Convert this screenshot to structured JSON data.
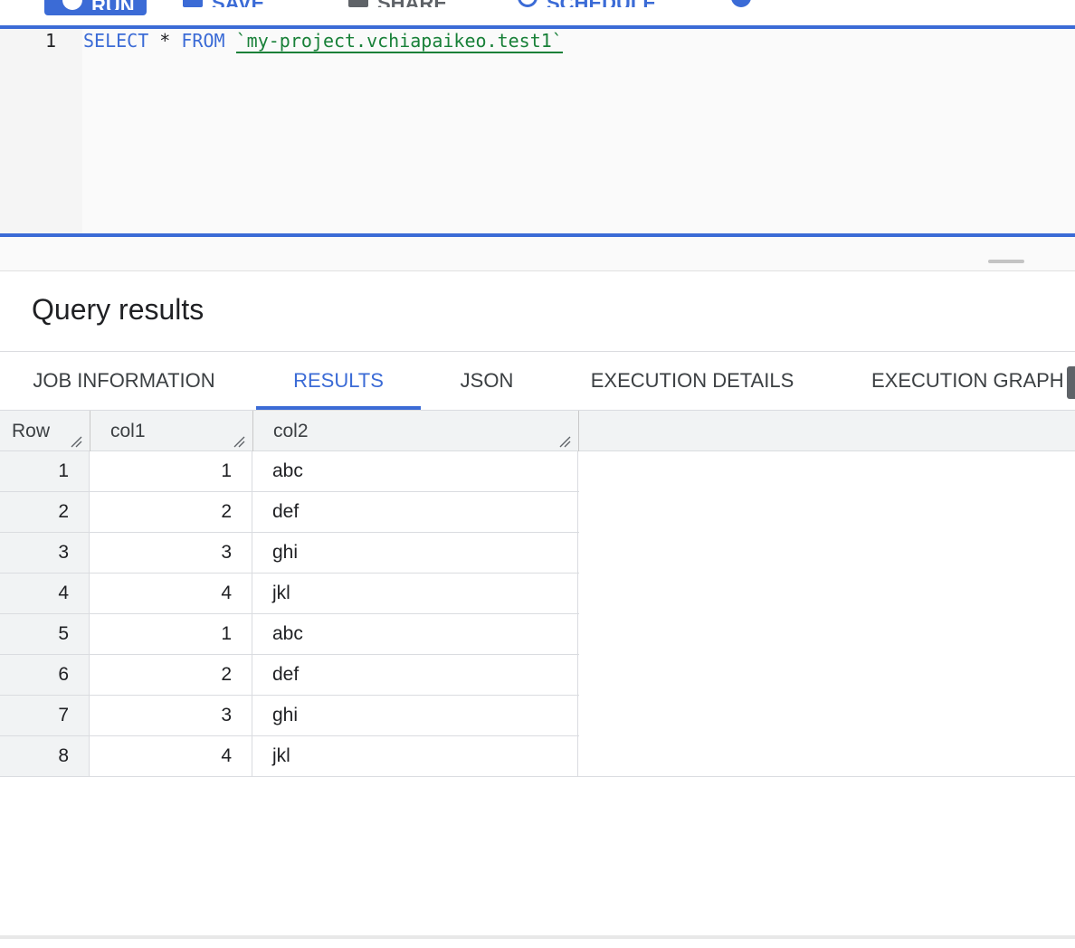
{
  "toolbar": {
    "run_label": "RUN",
    "save_label": "SAVE",
    "share_label": "SHARE",
    "schedule_label": "SCHEDULE"
  },
  "editor": {
    "line_number": "1",
    "select_kw": "SELECT",
    "star": "*",
    "from_kw": "FROM",
    "table_ref": "`my-project.vchiapaikeo.test1`"
  },
  "results": {
    "title": "Query results",
    "tabs": [
      {
        "label": "JOB INFORMATION"
      },
      {
        "label": "RESULTS"
      },
      {
        "label": "JSON"
      },
      {
        "label": "EXECUTION DETAILS"
      },
      {
        "label": "EXECUTION GRAPH"
      }
    ],
    "active_tab": "RESULTS",
    "columns": [
      "Row",
      "col1",
      "col2"
    ],
    "rows": [
      {
        "row": "1",
        "col1": "1",
        "col2": "abc"
      },
      {
        "row": "2",
        "col1": "2",
        "col2": "def"
      },
      {
        "row": "3",
        "col1": "3",
        "col2": "ghi"
      },
      {
        "row": "4",
        "col1": "4",
        "col2": "jkl"
      },
      {
        "row": "5",
        "col1": "1",
        "col2": "abc"
      },
      {
        "row": "6",
        "col1": "2",
        "col2": "def"
      },
      {
        "row": "7",
        "col1": "3",
        "col2": "ghi"
      },
      {
        "row": "8",
        "col1": "4",
        "col2": "jkl"
      }
    ]
  },
  "colors": {
    "accent": "#3b6bd6",
    "string": "#188038",
    "header_bg": "#f1f3f4"
  }
}
